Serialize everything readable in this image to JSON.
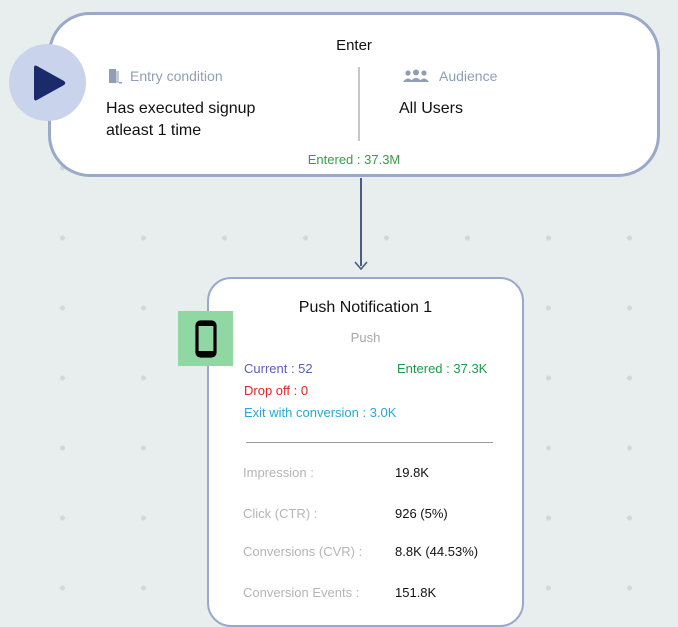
{
  "enter_node": {
    "title": "Enter",
    "entry_condition": {
      "label": "Entry condition",
      "icon": "door-icon",
      "value_line1": "Has executed signup",
      "value_line2": "atleast 1 time"
    },
    "audience": {
      "label": "Audience",
      "icon": "users-icon",
      "value": "All Users"
    },
    "entered": "Entered : 37.3M"
  },
  "push_node": {
    "title": "Push Notification 1",
    "channel": "Push",
    "icon": "mobile-phone-icon",
    "current": "Current : 52",
    "entered": "Entered : 37.3K",
    "drop_off": "Drop off : 0",
    "exit_conversion": "Exit with conversion : 3.0K",
    "metrics": [
      {
        "label": "Impression :",
        "value": "19.8K"
      },
      {
        "label": "Click (CTR) :",
        "value": "926 (5%)"
      },
      {
        "label": "Conversions (CVR) :",
        "value": "8.8K (44.53%)"
      },
      {
        "label": "Conversion Events :",
        "value": "151.8K"
      }
    ]
  },
  "colors": {
    "card_border": "#9aa9c9",
    "play_bg": "#c9d3ec",
    "play_triangle": "#1b2a6b",
    "entered_green": "#2fa04a",
    "current_purple": "#5b5fb5",
    "entered_push_green": "#1e9a4c",
    "drop_off_red": "#e02424",
    "exit_blue": "#2aa7d6",
    "phone_tile": "#8fd8a3"
  }
}
